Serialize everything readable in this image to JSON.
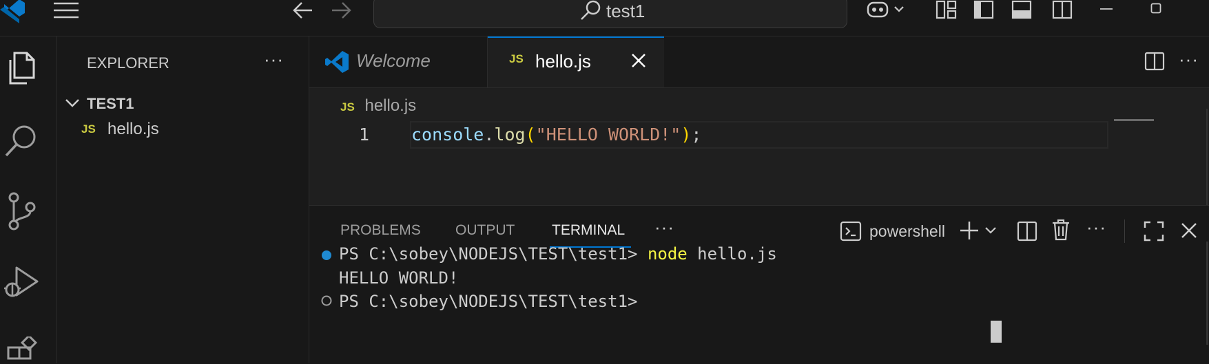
{
  "titlebar": {
    "search_text": "test1",
    "icons": [
      "vscode-logo",
      "menu-icon",
      "back-arrow-icon",
      "forward-arrow-icon",
      "search-icon",
      "copilot-icon",
      "layout-icon",
      "toggle-sidebar-icon",
      "toggle-panel-icon",
      "toggle-secondary-sidebar-icon",
      "minimize-icon",
      "maximize-icon"
    ]
  },
  "activitybar": {
    "items": [
      "explorer-icon",
      "search-icon",
      "source-control-icon",
      "run-debug-icon",
      "extensions-icon"
    ]
  },
  "sidebar": {
    "title": "EXPLORER",
    "more": "···",
    "folder": {
      "chevron": "chevron-down-icon",
      "name": "TEST1"
    },
    "files": [
      {
        "badge": "JS",
        "name": "hello.js"
      }
    ]
  },
  "tabs": [
    {
      "label": "Welcome",
      "icon": "vscode-logo",
      "active": false
    },
    {
      "label": "hello.js",
      "badge": "JS",
      "active": true,
      "close": "close-icon"
    }
  ],
  "editor_actions": {
    "more": "···"
  },
  "editor": {
    "breadcrumb": {
      "badge": "JS",
      "file": "hello.js"
    },
    "line_number": "1",
    "tokens": {
      "obj": "console",
      "dot": ".",
      "fn": "log",
      "open": "(",
      "str": "\"HELLO WORLD!\"",
      "close": ")",
      "semi": ";"
    }
  },
  "panel": {
    "tabs": [
      "PROBLEMS",
      "OUTPUT",
      "TERMINAL"
    ],
    "active_tab": "TERMINAL",
    "more": "···",
    "shell": "powershell",
    "terminal": {
      "line1_prompt": "PS C:\\sobey\\NODEJS\\TEST\\test1> ",
      "line1_cmd": "node",
      "line1_args": " hello.js",
      "line2_output": "HELLO WORLD!",
      "line3_prompt": "PS C:\\sobey\\NODEJS\\TEST\\test1> "
    }
  },
  "colors": {
    "accent": "#0078d4",
    "js_badge": "#cbcb41",
    "cmd": "#f5f543"
  }
}
